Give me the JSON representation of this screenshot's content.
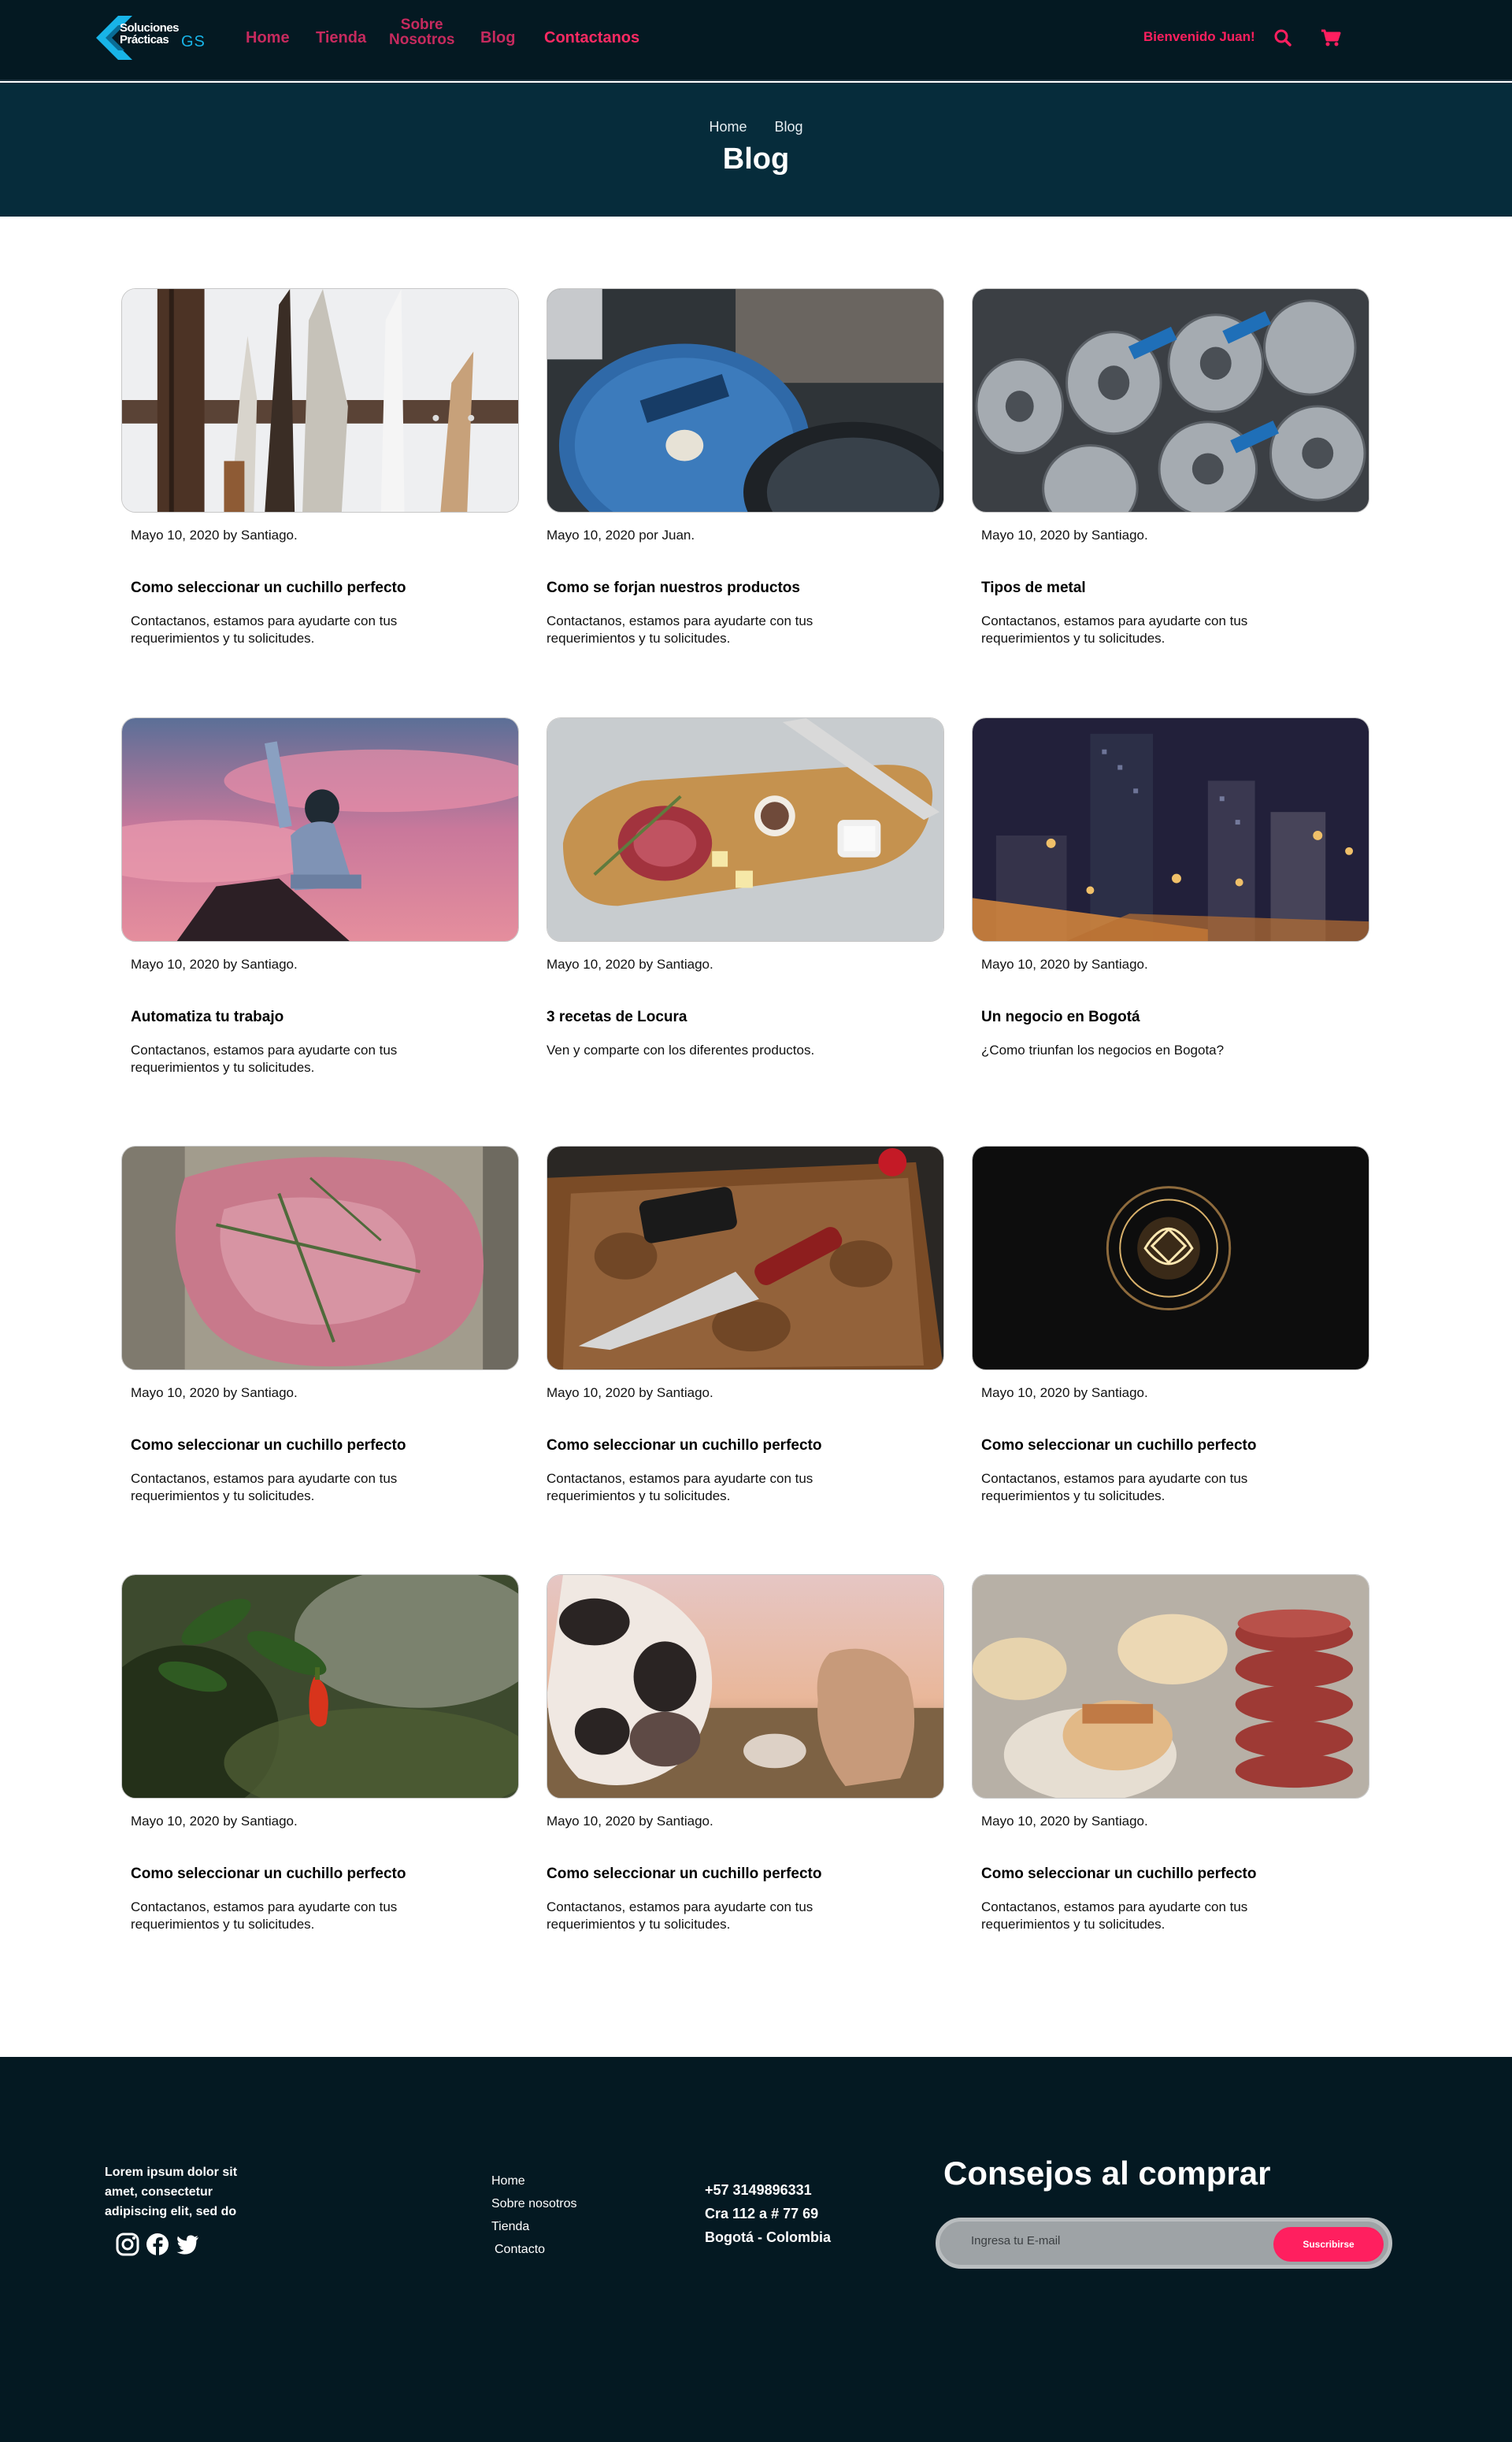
{
  "header": {
    "logo_text_1": "Soluciones",
    "logo_text_2": "Prácticas",
    "logo_gs": "GS",
    "nav": {
      "home": "Home",
      "tienda": "Tienda",
      "sobre_1": "Sobre",
      "sobre_2": "Nosotros",
      "blog": "Blog",
      "contacto": "Contactanos"
    },
    "welcome": "Bienvenido Juan!",
    "accent_color": "#ff1f5f"
  },
  "hero": {
    "breadcrumb": [
      "Home",
      "Blog"
    ],
    "title": "Blog"
  },
  "posts": [
    {
      "meta": "Mayo 10, 2020 by Santiago.",
      "title": "Como seleccionar un cuchillo perfecto",
      "excerpt": "Contactanos, estamos para ayudarte con tus requerimientos y tu solicitudes.",
      "image": "knives-on-magnetic-rack"
    },
    {
      "meta": "Mayo 10, 2020 por Juan.",
      "title": "Como se forjan nuestros productos",
      "excerpt": "Contactanos, estamos para ayudarte con tus requerimientos y tu solicitudes.",
      "image": "grinding-discs"
    },
    {
      "meta": "Mayo 10, 2020 by Santiago.",
      "title": "Tipos de metal",
      "excerpt": "Contactanos, estamos para ayudarte con tus requerimientos y tu solicitudes.",
      "image": "metal-rolls"
    },
    {
      "meta": "Mayo 10, 2020 by Santiago.",
      "title": "Automatiza tu trabajo",
      "excerpt": "Contactanos, estamos para ayudarte con tus requerimientos y tu solicitudes.",
      "image": "person-on-mountain"
    },
    {
      "meta": "Mayo 10, 2020 by Santiago.",
      "title": "3 recetas de Locura",
      "excerpt": "Ven y comparte con los diferentes productos.",
      "image": "meat-on-cutting-board"
    },
    {
      "meta": "Mayo 10, 2020 by Santiago.",
      "title": "Un negocio en Bogotá",
      "excerpt": "¿Como triunfan los negocios en Bogota?",
      "image": "city-night"
    },
    {
      "meta": "Mayo 10, 2020 by Santiago.",
      "title": "Como seleccionar un cuchillo perfecto",
      "excerpt": "Contactanos, estamos para ayudarte con tus requerimientos y tu solicitudes.",
      "image": "raw-steak-rosemary"
    },
    {
      "meta": "Mayo 10, 2020 by Santiago.",
      "title": "Como seleccionar un cuchillo perfecto",
      "excerpt": "Contactanos, estamos para ayudarte con tus requerimientos y tu solicitudes.",
      "image": "chef-knife-sharpener"
    },
    {
      "meta": "Mayo 10, 2020 by Santiago.",
      "title": "Como seleccionar un cuchillo perfecto",
      "excerpt": "Contactanos, estamos para ayudarte con tus requerimientos y tu solicitudes.",
      "image": "light-bulb"
    },
    {
      "meta": "Mayo 10, 2020 by Santiago.",
      "title": "Como seleccionar un cuchillo perfecto",
      "excerpt": "Contactanos, estamos para ayudarte con tus requerimientos y tu solicitudes.",
      "image": "chili-plant"
    },
    {
      "meta": "Mayo 10, 2020 by Santiago.",
      "title": "Como seleccionar un cuchillo perfecto",
      "excerpt": "Contactanos, estamos para ayudarte con tus requerimientos y tu solicitudes.",
      "image": "cows-at-sunset"
    },
    {
      "meta": "Mayo 10, 2020 by Santiago.",
      "title": "Como seleccionar un cuchillo perfecto",
      "excerpt": "Contactanos, estamos para ayudarte con tus requerimientos y tu solicitudes.",
      "image": "burger-patties"
    }
  ],
  "footer": {
    "lorem": "Lorem ipsum dolor sit amet, consectetur adipiscing elit, sed do",
    "social": [
      "instagram-icon",
      "facebook-icon",
      "twitter-icon"
    ],
    "links": [
      "Home",
      "Sobre nosotros",
      "Tienda",
      "Contacto"
    ],
    "phone": "+57 3149896331",
    "address": "Cra 112 a # 77 69",
    "city": "Bogotá - Colombia",
    "newsletter_title": "Consejos al comprar",
    "email_placeholder": "Ingresa tu E-mail",
    "subscribe_label": "Suscribirse"
  }
}
